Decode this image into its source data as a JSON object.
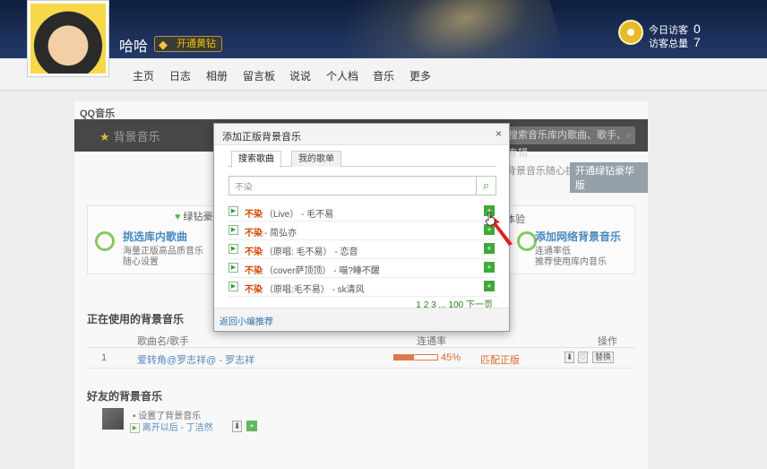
{
  "header": {
    "username": "哈哈",
    "vip_button": "开通黄钻",
    "visits_today_label": "今日访客",
    "visits_today": "0",
    "visits_total_label": "访客总量",
    "visits_total": "7"
  },
  "nav": [
    "主页",
    "日志",
    "相册",
    "留言板",
    "说说",
    "个人档",
    "音乐",
    "更多"
  ],
  "main": {
    "title": "QQ音乐",
    "bar_logo": "背景音乐",
    "bar_search_placeholder": "搜索音乐库内歌曲、歌手、专辑",
    "tip_text": "背景音乐随心挑选",
    "tip_button": "开通绿钻豪华版",
    "features": {
      "top_label": "绿钻豪华",
      "exp_label": "体验",
      "left_title": "挑选库内歌曲",
      "left_sub1": "海量正版高品质音乐",
      "left_sub2": "随心设置",
      "right_title": "添加网络背景音乐",
      "right_sub1": "连通率低",
      "right_sub2": "推荐使用库内音乐"
    },
    "current_section": "正在使用的背景音乐",
    "table_headers": {
      "song": "歌曲名/歌手",
      "rate": "连通率",
      "ops": "操作"
    },
    "current_song": {
      "index": "1",
      "title": "爱转角@罗志祥@ - 罗志祥",
      "rate_text": "45%",
      "rate": 0.45,
      "status": "匹配正版",
      "replace_btn": "替换"
    },
    "friends_section": "好友的背景音乐",
    "friend": {
      "action": "设置了背景音乐",
      "song": "离开以后 - 丁洁然"
    }
  },
  "dialog": {
    "title": "添加正版背景音乐",
    "close": "×",
    "tabs": [
      "搜索歌曲",
      "我的歌单"
    ],
    "search_value": "不染",
    "results": [
      {
        "title": "不染",
        "extra": "（Live） - 毛不易"
      },
      {
        "title": "不染",
        "extra": " - 简弘亦"
      },
      {
        "title": "不染",
        "extra": "（原唱: 毛不易） - 恋音"
      },
      {
        "title": "不染",
        "extra": "（cover萨顶顶） - 喵?睡不醒"
      },
      {
        "title": "不染",
        "extra": "（原唱:毛不易） - sk清风"
      }
    ],
    "pager": "1 2 3 ... 100 下一页",
    "footer_link": "返回小编推荐"
  },
  "colors": {
    "accent_green": "#3fa83a",
    "song_title_orange": "#d14a00",
    "link_blue": "#2f6fb1"
  }
}
